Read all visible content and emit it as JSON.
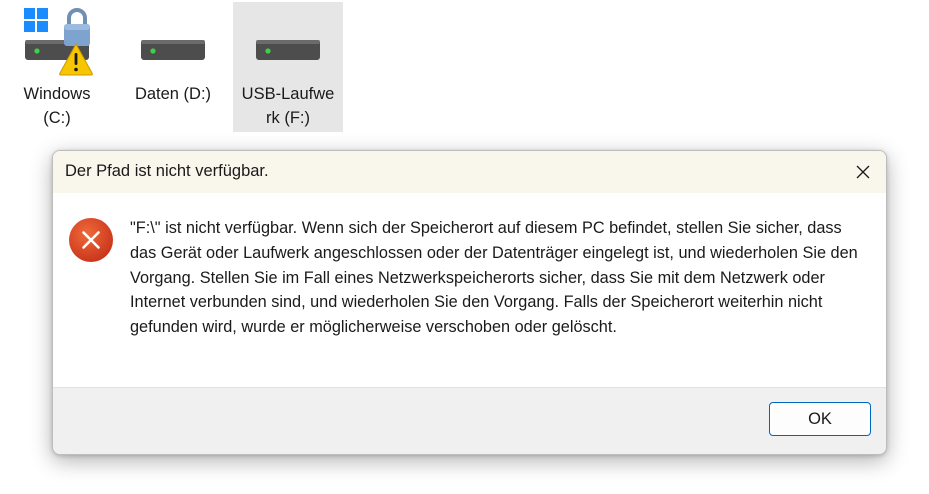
{
  "drives": [
    {
      "label": "Windows (C:)",
      "icon": "hard-drive-icon",
      "badges": [
        "windows-logo-icon",
        "lock-icon",
        "warning-icon"
      ],
      "selected": false
    },
    {
      "label": "Daten (D:)",
      "icon": "hard-drive-icon",
      "selected": false
    },
    {
      "label": "USB-Laufwerk (F:)",
      "icon": "hard-drive-icon",
      "selected": true
    }
  ],
  "dialog": {
    "title": "Der Pfad ist nicht verfügbar.",
    "close_icon": "close-icon",
    "error_icon": "error-x-icon",
    "message": "\"F:\\\" ist nicht verfügbar. Wenn sich der Speicherort auf diesem PC befindet, stellen Sie sicher, dass das Gerät oder Laufwerk angeschlossen oder der Datenträger eingelegt ist, und wiederholen Sie den Vorgang. Stellen Sie im Fall eines Netzwerkspeicherorts sicher, dass Sie mit dem Netzwerk oder Internet verbunden sind, und wiederholen Sie den Vorgang. Falls der Speicherort weiterhin nicht gefunden wird, wurde er möglicherweise verschoben oder gelöscht.",
    "ok_label": "OK"
  },
  "colors": {
    "titlebar_bg": "#f9f6ec",
    "footer_bg": "#f0f0f0",
    "error_red": "#d8431c",
    "accent_blue": "#0067c0",
    "warning_yellow": "#f7c600",
    "selection_bg": "#e6e6e6"
  }
}
